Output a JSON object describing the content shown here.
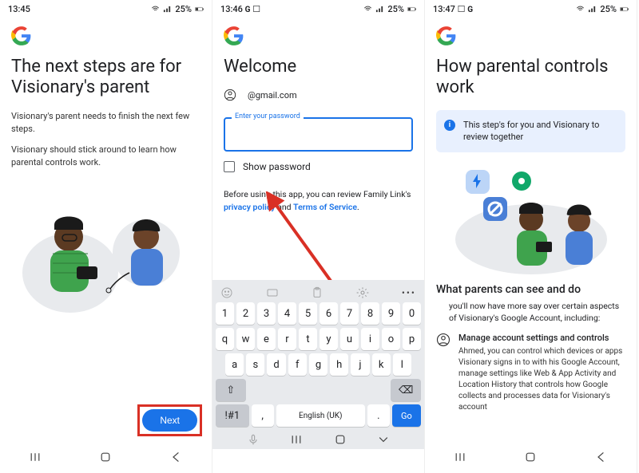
{
  "screen1": {
    "time": "13:45",
    "battery": "25%",
    "title": "The next steps are for Visionary's parent",
    "para1": "Visionary's parent needs to finish the next few steps.",
    "para2": "Visionary should stick around to learn how parental controls work.",
    "next_label": "Next"
  },
  "screen2": {
    "time": "13:46",
    "battery": "25%",
    "title": "Welcome",
    "email": "@gmail.com",
    "password_label": "Enter your password",
    "show_password": "Show password",
    "legal_pre": "Before using this app, you can review Family Link's ",
    "privacy": "privacy policy",
    "legal_mid": " and ",
    "tos": "Terms of Service",
    "legal_end": ".",
    "keyboard": {
      "row1": [
        "1",
        "2",
        "3",
        "4",
        "5",
        "6",
        "7",
        "8",
        "9",
        "0"
      ],
      "row2": [
        "q",
        "w",
        "e",
        "r",
        "t",
        "y",
        "u",
        "i",
        "o",
        "p"
      ],
      "row3": [
        "a",
        "s",
        "d",
        "f",
        "g",
        "h",
        "j",
        "k",
        "l"
      ],
      "row4": [
        "z",
        "x",
        "c",
        "v",
        "b",
        "n",
        "m"
      ],
      "shift": "⇧",
      "backspace": "⌫",
      "symbols": "!#1",
      "comma": ",",
      "space": "English (UK)",
      "period": ".",
      "go": "Go"
    }
  },
  "screen3": {
    "time": "13:47",
    "battery": "25%",
    "title": "How parental controls work",
    "banner": "This step's for you and Visionary to review together",
    "subtitle": "What parents can see and do",
    "intro": "you'll now have more say over certain aspects of Visionary's Google Account, including:",
    "mgmt_title": "Manage account settings and controls",
    "mgmt_body": "Ahmed, you can control which devices or apps Visionary signs in to with his Google Account, manage settings like Web & App Activity and Location History that controls how Google collects and processes data for Visionary's account"
  }
}
